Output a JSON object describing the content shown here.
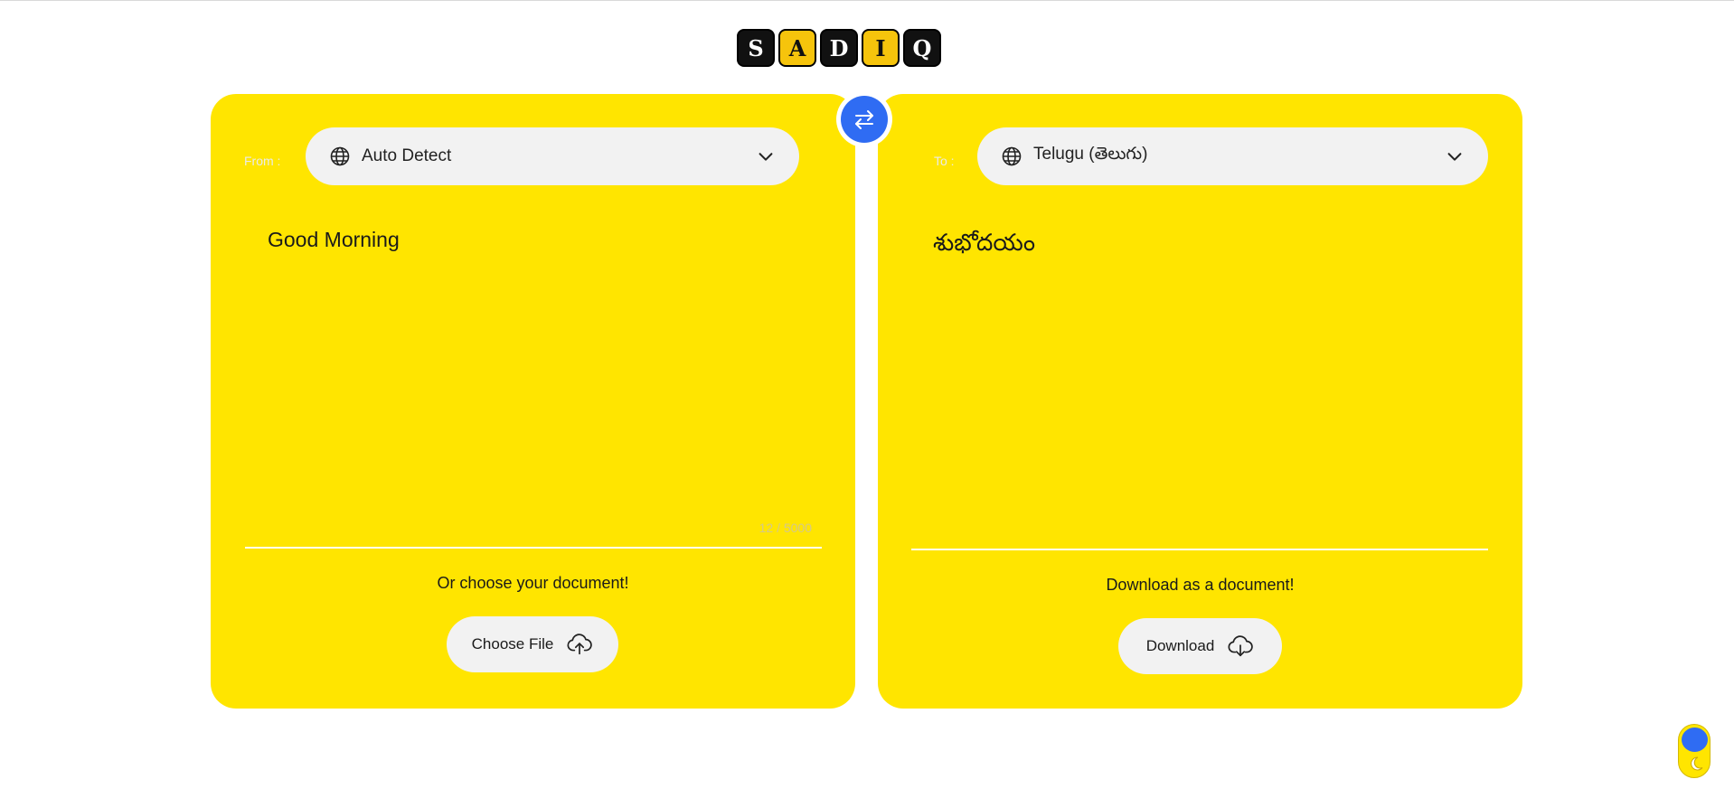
{
  "logo": {
    "letters": [
      "S",
      "A",
      "D",
      "I",
      "Q"
    ]
  },
  "source": {
    "label": "From :",
    "language": "Auto Detect",
    "text": "Good Morning",
    "counter": "12 / 5000",
    "upload_prompt": "Or choose your document!",
    "upload_button": "Choose File"
  },
  "target": {
    "label": "To :",
    "language": "Telugu (తెలుగు)",
    "text": "శుభోదయం",
    "download_prompt": "Download as a document!",
    "download_button": "Download"
  },
  "icons": {
    "language": "globe-icon",
    "dropdown": "chevron-down-icon",
    "swap": "swap-arrows-icon",
    "upload": "cloud-upload-icon",
    "download": "cloud-download-icon",
    "theme": "moon-icon"
  },
  "colors": {
    "panel": "#ffe500",
    "accent": "#2f6cf3",
    "pill": "#f2f2f2",
    "logo_dark": "#111111",
    "logo_light": "#f6c40c"
  }
}
